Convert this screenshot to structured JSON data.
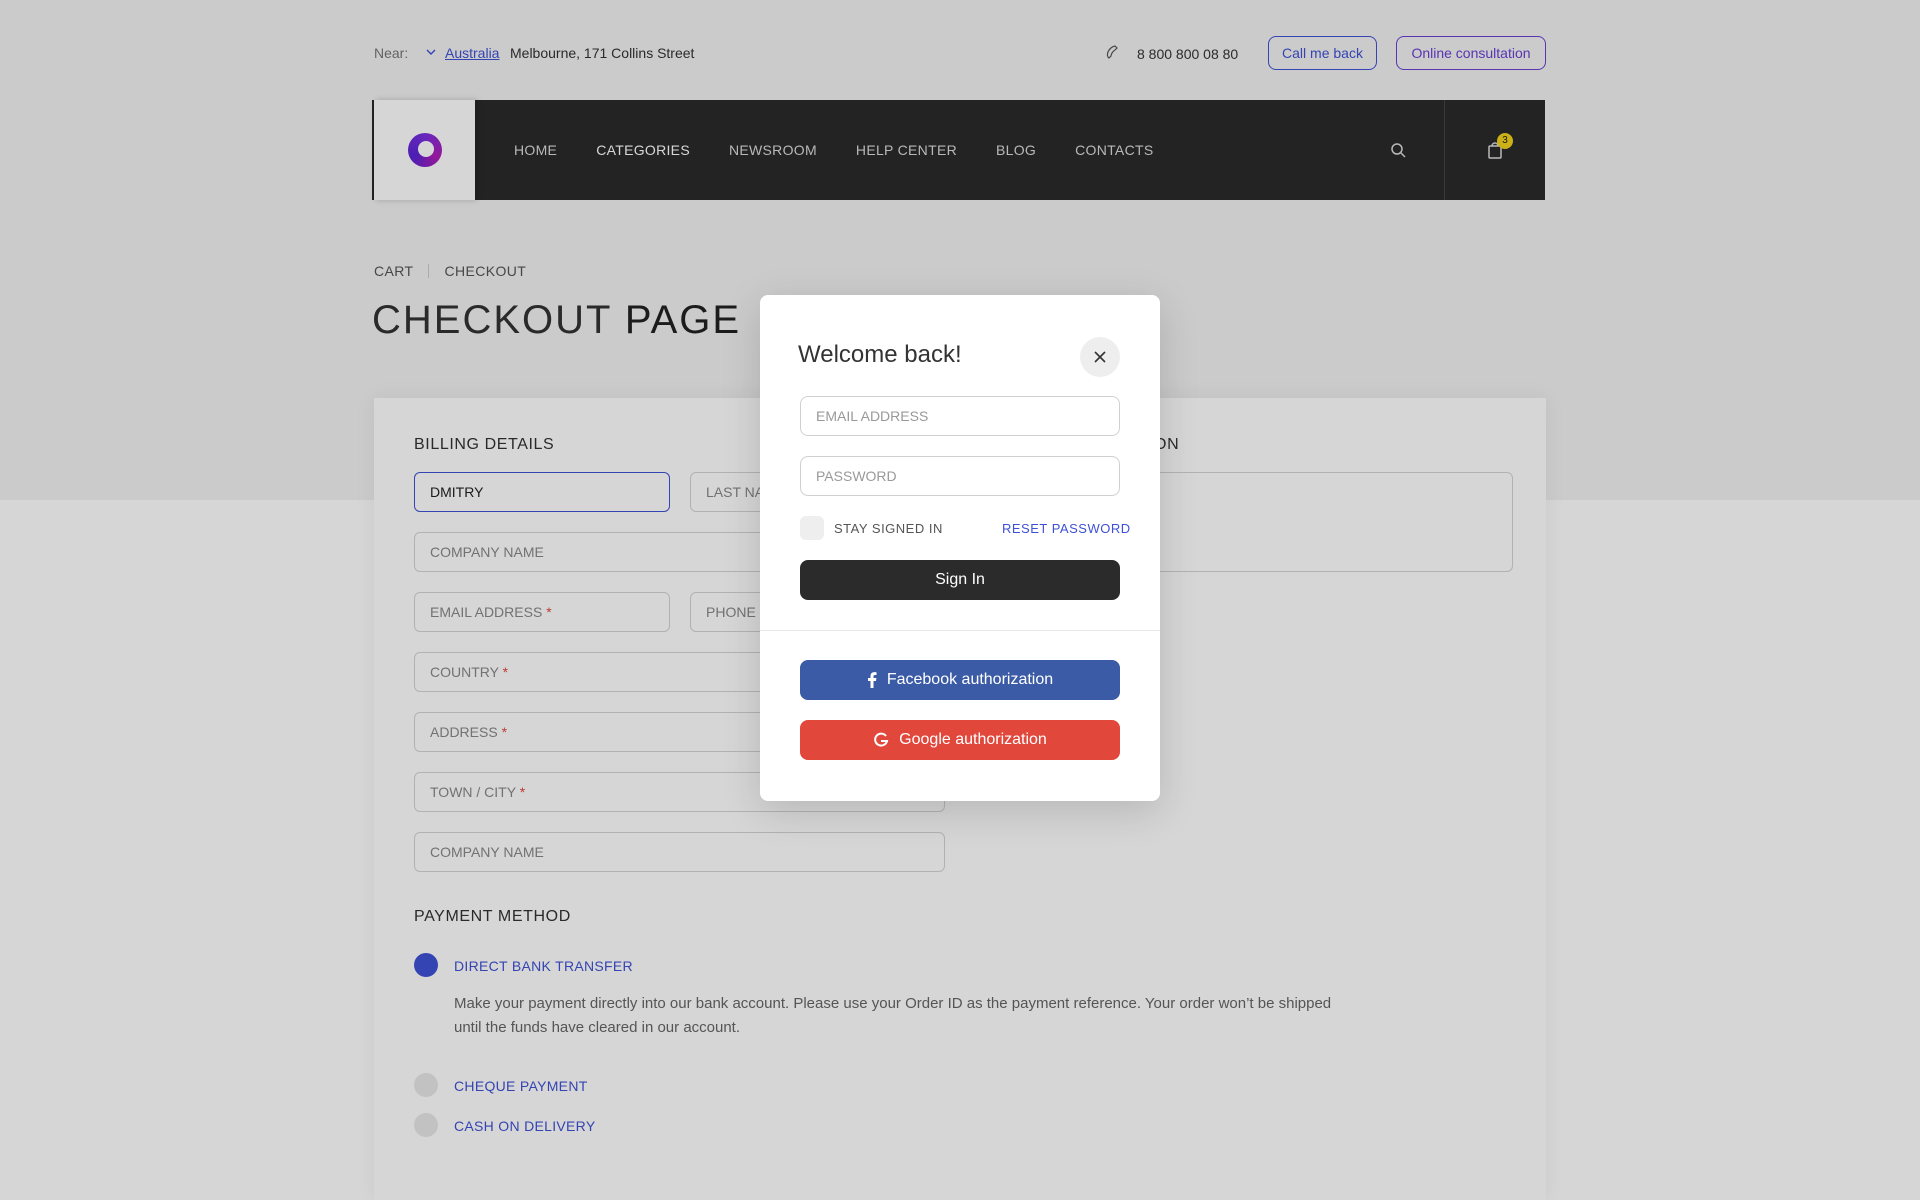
{
  "topbar": {
    "near_label": "Near:",
    "country": "Australia",
    "address": "Melbourne, 171 Collins Street",
    "phone": "8 800 800 08 80",
    "callback_label": "Call me back",
    "consultation_label": "Online consultation"
  },
  "nav": {
    "items": [
      {
        "label": "HOME"
      },
      {
        "label": "CATEGORIES"
      },
      {
        "label": "NEWSROOM"
      },
      {
        "label": "HELP CENTER"
      },
      {
        "label": "BLOG"
      },
      {
        "label": "CONTACTS"
      }
    ],
    "cart_count": "3"
  },
  "breadcrumb": [
    "CART",
    "CHECKOUT"
  ],
  "page_title": {
    "light": "CHECKOUT",
    "bold": "PAGE"
  },
  "billing": {
    "title": "BILLING DETAILS",
    "first_name_value": "DMITRY",
    "last_name_placeholder": "LAST NA",
    "company_placeholder": "COMPANY NAME",
    "email_placeholder": "EMAIL ADDRESS",
    "phone_placeholder": "PHONE",
    "country_placeholder": "COUNTRY",
    "address_placeholder": "ADDRESS",
    "town_placeholder": "TOWN / CITY",
    "company2_placeholder": "COMPANY NAME",
    "required_mark": "*"
  },
  "additional": {
    "title_fragment": "ION"
  },
  "payment": {
    "title": "PAYMENT METHOD",
    "options": [
      {
        "label": "DIRECT BANK TRANSFER",
        "selected": true
      },
      {
        "label": "CHEQUE PAYMENT",
        "selected": false
      },
      {
        "label": "CASH ON DELIVERY",
        "selected": false
      }
    ],
    "description": "Make your payment directly into our bank account. Please use your Order ID as the payment reference. Your order won’t be shipped until the funds have cleared in our account."
  },
  "modal": {
    "title": "Welcome back!",
    "email_placeholder": "EMAIL ADDRESS",
    "password_placeholder": "PASSWORD",
    "stay_signed_in": "STAY SIGNED IN",
    "reset_password": "RESET PASSWORD",
    "sign_in": "Sign In",
    "facebook": "Facebook authorization",
    "google": "Google authorization"
  },
  "colors": {
    "accent": "#3e51d6",
    "nav_bg": "#2a2a2a",
    "facebook": "#3b5ba6",
    "google": "#e2473c",
    "badge": "#f2d21c"
  },
  "icons": [
    "chevron-down-icon",
    "phone-icon",
    "logo-icon",
    "search-icon",
    "cart-icon",
    "close-icon",
    "facebook-icon",
    "google-icon"
  ]
}
